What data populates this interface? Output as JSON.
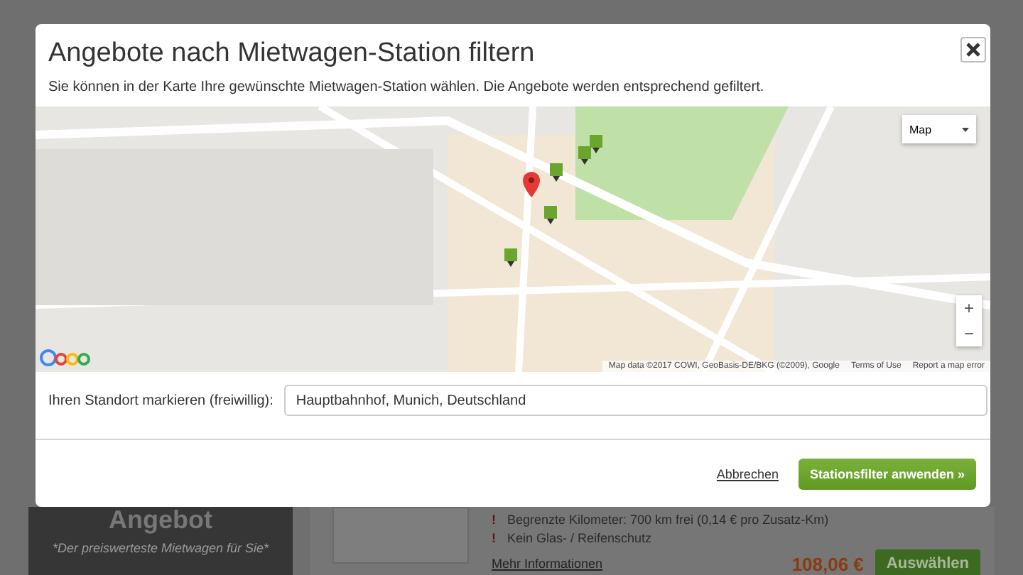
{
  "dialog": {
    "title": "Angebote nach Mietwagen-Station filtern",
    "description": "Sie können in der Karte Ihre gewünschte Mietwagen-Station wählen. Die Angebote werden entsprechend gefiltert.",
    "map": {
      "type_select": "Map",
      "zoom_in": "+",
      "zoom_out": "−",
      "attribution": "Map data ©2017 COWI, GeoBasis-DE/BKG (©2009), Google",
      "terms": "Terms of Use",
      "report": "Report a map error"
    },
    "location": {
      "label": "Ihren Standort markieren (freiwillig):",
      "value": "Hauptbahnhof, Munich, Deutschland"
    },
    "cancel": "Abbrechen",
    "apply": "Stationsfilter anwenden »"
  },
  "background": {
    "offer_title": "Angebot",
    "tagline": "*Der preiswerteste Mietwagen für Sie*",
    "features": [
      {
        "mark": "!",
        "text": "Begrenzte Kilometer: 700 km frei (0,14 € pro Zusatz-Km)"
      },
      {
        "mark": "!",
        "text": "Kein Glas- / Reifenschutz"
      }
    ],
    "more": "Mehr Informationen",
    "price": "108,06 €",
    "select": "Auswählen"
  }
}
